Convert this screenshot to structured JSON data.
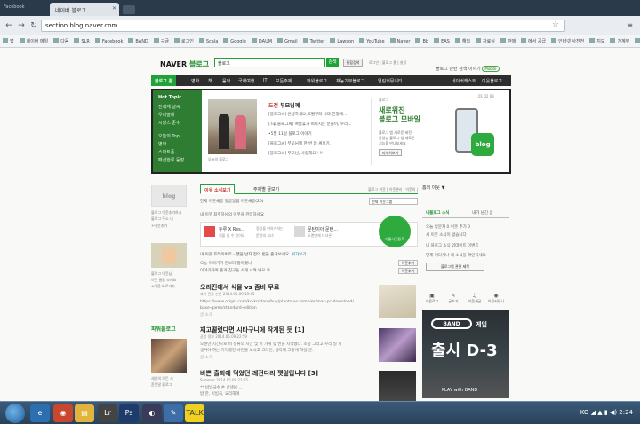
{
  "browser": {
    "tab_left": "Facebook",
    "tab_title": "네이버 블로그",
    "url": "section.blog.naver.com",
    "bookmarks": [
      "앱",
      "네이버 메일",
      "다음",
      "SLR",
      "Facebook",
      "BAND",
      "구글",
      "로그인",
      "Scala",
      "Google",
      "DAUM",
      "Gmail",
      "Twitter",
      "Lawson",
      "YouTube",
      "Naver",
      "Bb",
      "EAS",
      "해외",
      "자료실",
      "판매",
      "에서 공급",
      "인터넷 사진전",
      "지도",
      "가계부",
      "블로그",
      "Ynet"
    ]
  },
  "header": {
    "logo_naver": "NAVER",
    "logo_blog": "블로그",
    "search_placeholder": "블로그",
    "search_button": "검색",
    "search_option": "통합검색",
    "top_links": "로그인  |  블로그 홈  |  설정",
    "top_links2": "블로그 관련 검색 이야기",
    "mobile_label": "Mobile"
  },
  "gnb": {
    "home": "블로그 홈",
    "items": [
      "영화",
      "책",
      "음악",
      "국내여행",
      "IT",
      "모든주제",
      "파워블로그",
      "재능기부블로그",
      "열린커뮤니티"
    ],
    "right": [
      "네이버캐스트",
      "이웃블로그"
    ]
  },
  "hot": {
    "title": "Hot Topic",
    "links": [
      "전세계 날씨",
      "우리말배",
      "시장스 준수",
      "오늘의 Top",
      "영화",
      "스마트폰",
      "패션한류 등장"
    ],
    "photo_caption": "오늘의 블로그",
    "headline_tag": "도전",
    "headline": "부모님께",
    "lines": [
      "[블로그씨] 안녕하세요, 5월부터 나와 친정에...",
      "[Tip.블로그씨] 여름휴가 떠나시는 분들이, 우리...",
      "•5월 11일 블로그 이야기",
      "[블로그씨] 부모님께 한 번 쯤 써보기.",
      "[블로그씨] 부모님, 사랑해요♡!!"
    ],
    "promo_small": "블로그",
    "promo_title": "새로워진\n블로그 모바일",
    "promo_sub": "블로그 앱 새로운 버전,\n동영상 블로그 앱 새로운\n기능을 만나보세요",
    "promo_btn": "자세히보기",
    "promo_page": "01  02  03",
    "badge": "blog"
  },
  "left": {
    "blog_box": "blog",
    "cap1": "블로그 이웃추가하시",
    "cap2": "블로그 주소 내",
    "cap3": "+이웃추가",
    "cap4": "블로그 이웃님",
    "cap5": "이웃 글을 보세요",
    "cap6": "+이웃 바로가기",
    "power_title": "파워블로그",
    "power_cap1": "세상의 모든 시",
    "power_cap2": "혼잣말 블로그"
  },
  "feed": {
    "tab_active": "이웃 소식보기",
    "tab2": "주제별 글보기",
    "tab_right": "블로그 이웃  |  이웃관리  |  이웃의  |",
    "sub": "전체   이웃새글   댓글알림   이웃새글(20)",
    "select": "전체 이웃그룹",
    "notice": "내 이웃 최주하냥의 이웃을 관리하세요",
    "rec1": "두루 X Res...",
    "rec1b": "적을 일 수 있어요",
    "rec2": "정성을 이야기하는",
    "rec3": "문방의 자녀",
    "rec4": "문탄이아 문탄...",
    "rec4b": "오랜만에 다녀온",
    "chat_badge": "커플사진등록",
    "notice2": "내 이웃 프레이버트 - 했을 날자 정의 법을 즐겨보세요.",
    "notice2_link": "위가보기",
    "cm1": "오늘 이야기가 전보다 많아졌니",
    "cm2": "이야기하며 즐겨 친구들 소개 시켜 봐요 주",
    "cm_btn": "이웃추가",
    "posts": [
      {
        "title": "오리진에서 식물 vs 좀비 무료",
        "meta": "과거 전동 본문  2014.05.09 19:45",
        "lines": [
          "https://www.origin.com/ko-kr/store/buy/plants-vs-zombies/mac-pc-download/",
          "base-game/standard-edition",
          "글 소개"
        ]
      },
      {
        "title": "재고떨렸다면 시타구니에 작게된 듯 [1]",
        "meta": "공방 정보  2014.05.09 22:59",
        "lines": [
          "오랜만 시간으로 비 정류의 시간 및 이 가게 몇 번을 시작했다. 소중 그리고 우리 일 시",
          "생겨야 하는 기억했던 사진을 보시고 그러면, 생각해 그렇게 하실 분.",
          "글 소개"
        ]
      },
      {
        "title": "바쁜 출퇴에 먹었던 레전다리 깻잎입니다 [3]",
        "meta": "Summer  2014.05.09 21:55",
        "lines": [
          "** 비빔국수 손 선생님 ...",
          "밥 한, 비빔국, 요리해에"
        ]
      }
    ]
  },
  "right": {
    "head": "홈의 이웃 ▼",
    "tab1": "내블로그 소식",
    "tab2": "내가 남긴 글",
    "line1": "오늘 방문자 0  이웃 추가 0",
    "line2": "새 이웃 소식이 없습니다",
    "line3": "내 블로그 소식 업데이트 이벤트",
    "line4": "언제 어디서나 내 소식을 확인하세요",
    "btn": "블로그앱 관련 제작",
    "icons": [
      {
        "glyph": "▣",
        "label": "내블로그"
      },
      {
        "glyph": "✎",
        "label": "글쓰기"
      },
      {
        "glyph": "♫",
        "label": "이웃새글"
      },
      {
        "glyph": "◉",
        "label": "이웃커뮤니"
      }
    ],
    "band_logo": "BAND",
    "band_game": "게임",
    "band_big": "출시 D-3",
    "band_play": "PLAY with BAND"
  },
  "taskbar": {
    "tray": "KO ◢ ▲ ▮ ◀)  2:24"
  }
}
